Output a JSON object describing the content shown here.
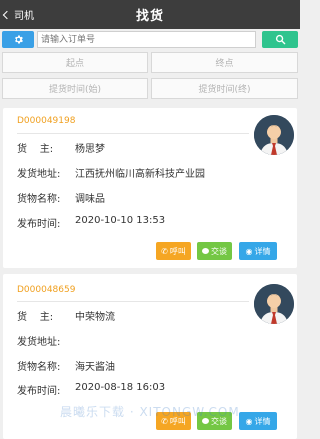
{
  "header": {
    "back_label": "司机",
    "title": "找货"
  },
  "search": {
    "placeholder": "请输入订单号"
  },
  "filters": {
    "start": "起点",
    "end": "终点",
    "pickup_start": "提货时间(始)",
    "pickup_end": "提货时间(终)"
  },
  "labels": {
    "shipper": "货    主:",
    "address": "发货地址:",
    "goods": "货物名称:",
    "time": "发布时间:"
  },
  "buttons": {
    "call": "呼叫",
    "chat": "交谈",
    "detail": "详情"
  },
  "orders": [
    {
      "id": "D000049198",
      "shipper": "杨思梦",
      "address": "江西抚州临川高新科技产业园",
      "goods": "调味品",
      "time": "2020-10-10 13:53"
    },
    {
      "id": "D000048659",
      "shipper": "中荣物流",
      "address": "",
      "goods": "海天酱油",
      "time": "2020-08-18 16:03"
    }
  ],
  "watermark": "晨曦乐下载 · XITONGW.COM",
  "colors": {
    "topbar": "#3d3d3d",
    "gear_button": "#3aa0e6",
    "search_button": "#2fc48e",
    "order_id": "#f0a020",
    "call": "#f5a623",
    "chat": "#74c744",
    "detail": "#35a7e8"
  }
}
